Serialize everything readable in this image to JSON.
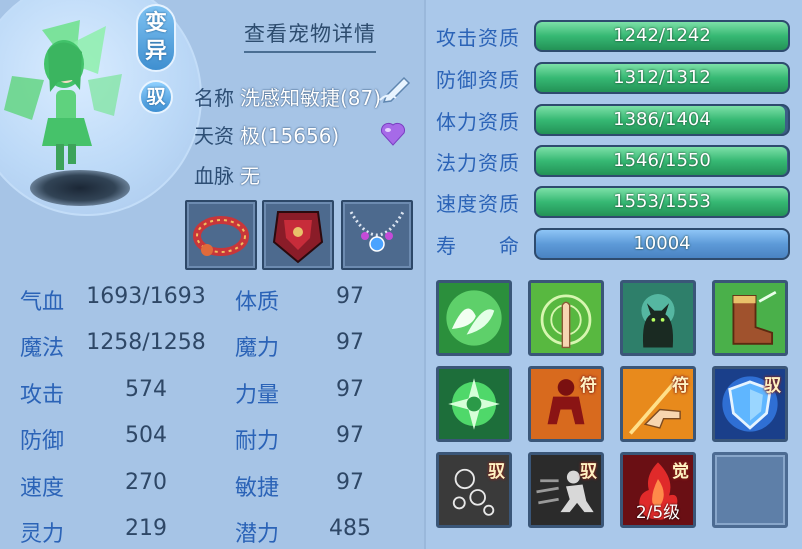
{
  "pet": {
    "transform_badge": "变异",
    "ride_badge": "驭",
    "detail_link": "查看宠物详情",
    "name_label": "名称",
    "name_value": "洗感知敏捷(87)",
    "aptitude_label": "天资",
    "aptitude_value": "极(15656)",
    "bloodline_label": "血脉",
    "bloodline_value": "无"
  },
  "equipment": [
    "collar-equip",
    "armor-equip",
    "necklace-equip"
  ],
  "stats_left": [
    {
      "label": "气血",
      "value": "1693/1693"
    },
    {
      "label": "魔法",
      "value": "1258/1258"
    },
    {
      "label": "攻击",
      "value": "574"
    },
    {
      "label": "防御",
      "value": "504"
    },
    {
      "label": "速度",
      "value": "270"
    },
    {
      "label": "灵力",
      "value": "219"
    }
  ],
  "stats_right": [
    {
      "label": "体质",
      "value": "97"
    },
    {
      "label": "魔力",
      "value": "97"
    },
    {
      "label": "力量",
      "value": "97"
    },
    {
      "label": "耐力",
      "value": "97"
    },
    {
      "label": "敏捷",
      "value": "97"
    },
    {
      "label": "潜力",
      "value": "485"
    }
  ],
  "aptitudes": [
    {
      "label": "攻击资质",
      "value": "1242/1242",
      "fraction": 1.0
    },
    {
      "label": "防御资质",
      "value": "1312/1312",
      "fraction": 1.0
    },
    {
      "label": "体力资质",
      "value": "1386/1404",
      "fraction": 0.987
    },
    {
      "label": "法力资质",
      "value": "1546/1550",
      "fraction": 0.997
    },
    {
      "label": "速度资质",
      "value": "1553/1553",
      "fraction": 1.0
    },
    {
      "label": "寿　　命",
      "value": "10004",
      "fraction": 1.0
    }
  ],
  "skills": [
    {
      "icon": "wings-skill-icon",
      "tag": ""
    },
    {
      "icon": "finger-point-skill-icon",
      "tag": ""
    },
    {
      "icon": "cat-skill-icon",
      "tag": ""
    },
    {
      "icon": "boot-skill-icon",
      "tag": ""
    },
    {
      "icon": "green-orb-skill-icon",
      "tag": ""
    },
    {
      "icon": "red-figure-skill-icon",
      "tag": "符"
    },
    {
      "icon": "pointing-hand-skill-icon",
      "tag": "符"
    },
    {
      "icon": "shield-skill-icon",
      "tag": "驭"
    },
    {
      "icon": "bubbles-skill-icon",
      "tag": "驭"
    },
    {
      "icon": "running-figure-skill-icon",
      "tag": "驭"
    },
    {
      "icon": "flame-skill-icon",
      "tag": "觉",
      "level": "2/5级"
    },
    {
      "icon": "empty-skill-slot",
      "tag": ""
    }
  ],
  "colors": {
    "label_blue": "#2b63b7",
    "bar_green": "#36b873",
    "bar_blue": "#5d9ad8"
  }
}
